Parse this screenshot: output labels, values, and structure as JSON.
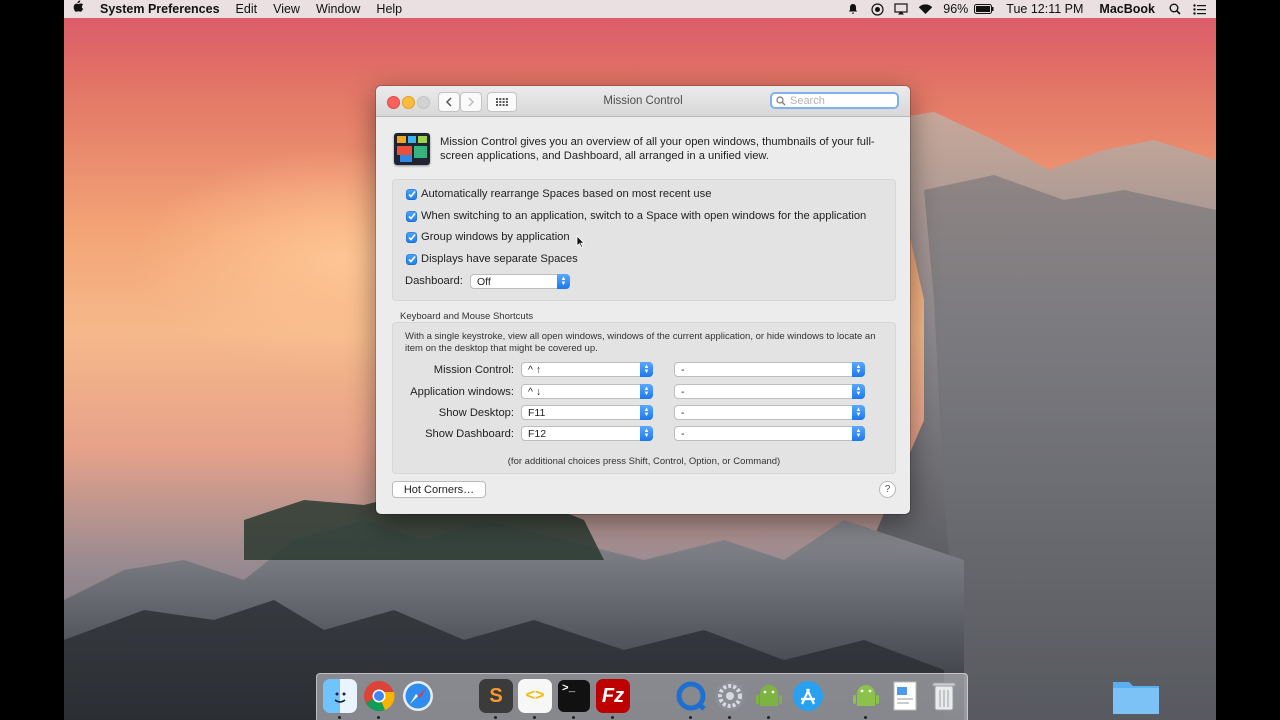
{
  "menubar": {
    "apple_icon": "apple-icon",
    "app_name": "System Preferences",
    "menus": [
      "Edit",
      "View",
      "Window",
      "Help"
    ],
    "battery": "96%",
    "clock": "Tue 12:11 PM",
    "user": "MacBook"
  },
  "window": {
    "title": "Mission Control",
    "search_placeholder": "Search",
    "intro": "Mission Control gives you an overview of all your open windows, thumbnails of your full-screen applications, and Dashboard, all arranged in a unified view.",
    "options": [
      {
        "label": "Automatically rearrange Spaces based on most recent use",
        "checked": true
      },
      {
        "label": "When switching to an application, switch to a Space with open windows for the application",
        "checked": true
      },
      {
        "label": "Group windows by application",
        "checked": true
      },
      {
        "label": "Displays have separate Spaces",
        "checked": true
      }
    ],
    "dashboard_label": "Dashboard:",
    "dashboard_value": "Off",
    "shortcuts_heading": "Keyboard and Mouse Shortcuts",
    "shortcuts_desc": "With a single keystroke, view all open windows, windows of the current application, or hide windows to locate an item on the desktop that might be covered up.",
    "shortcuts": [
      {
        "label": "Mission Control:",
        "key": "^ ↑",
        "mouse": "-"
      },
      {
        "label": "Application windows:",
        "key": "^ ↓",
        "mouse": "-"
      },
      {
        "label": "Show Desktop:",
        "key": "F11",
        "mouse": "-"
      },
      {
        "label": "Show Dashboard:",
        "key": "F12",
        "mouse": "-"
      }
    ],
    "footnote": "(for additional choices press Shift, Control, Option, or Command)",
    "hot_corners": "Hot Corners…",
    "help": "?"
  },
  "dock": {
    "apps": [
      "finder-icon",
      "chrome-icon",
      "safari-icon",
      "sublime-text-icon",
      "brackets-icon",
      "terminal-icon",
      "filezilla-icon",
      "quicktime-icon",
      "system-preferences-icon",
      "android-studio-icon",
      "app-store-icon",
      "android-icon",
      "preview-icon",
      "trash-icon"
    ]
  },
  "colors": {
    "checkbox": "#1f7ff0",
    "close": "#fc605c",
    "minimize": "#fdbc40"
  }
}
